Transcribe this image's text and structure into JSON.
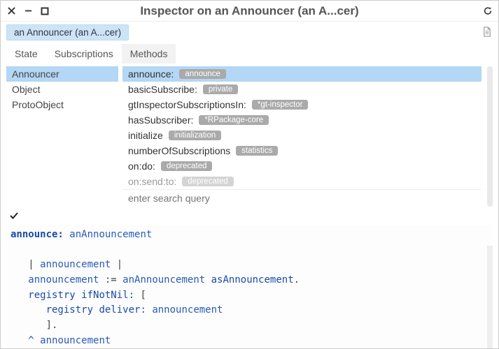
{
  "window": {
    "title": "Inspector on an Announcer (an A...cer)"
  },
  "breadcrumb": {
    "label": "an Announcer (an A...cer)"
  },
  "tabs": [
    {
      "label": "State",
      "active": false
    },
    {
      "label": "Subscriptions",
      "active": false
    },
    {
      "label": "Methods",
      "active": true
    }
  ],
  "classes": [
    {
      "name": "Announcer",
      "selected": true
    },
    {
      "name": "Object",
      "selected": false
    },
    {
      "name": "ProtoObject",
      "selected": false
    }
  ],
  "methods": {
    "header": {
      "name": "announce:",
      "badge": "announce"
    },
    "rows": [
      {
        "name": "basicSubscribe:",
        "badge": "private"
      },
      {
        "name": "gtInspectorSubscriptionsIn:",
        "badge": "*gt-inspector"
      },
      {
        "name": "hasSubscriber:",
        "badge": "*RPackage-core"
      },
      {
        "name": "initialize",
        "badge": "initialization"
      },
      {
        "name": "numberOfSubscriptions",
        "badge": "statistics"
      },
      {
        "name": "on:do:",
        "badge": "deprecated"
      },
      {
        "name": "on:send:to:",
        "badge": "deprecated",
        "cut": true
      }
    ],
    "search_placeholder": "enter search query"
  },
  "code": {
    "selector": "announce:",
    "arg": "anAnnouncement",
    "lines": {
      "l1a": "| ",
      "l1b": "announcement",
      "l1c": " |",
      "l2a": "announcement",
      "l2b": " := ",
      "l2c": "anAnnouncement",
      "l2d": " asAnnouncement",
      "l2e": ".",
      "l3a": "registry",
      "l3b": " ifNotNil: ",
      "l3c": "[",
      "l4a": "registry",
      "l4b": " deliver: ",
      "l4c": "announcement",
      "l5a": "]",
      "l5b": ".",
      "l6a": "^ ",
      "l6b": "announcement"
    }
  }
}
